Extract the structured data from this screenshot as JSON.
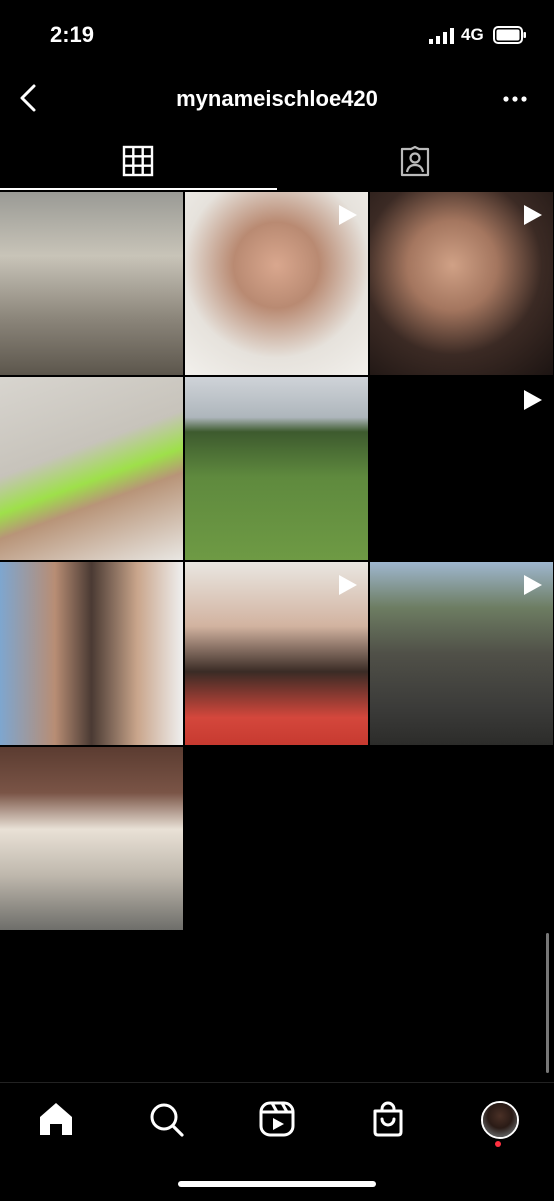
{
  "status_bar": {
    "time": "2:19",
    "network": "4G",
    "icons": [
      "signal-icon",
      "battery-icon"
    ]
  },
  "header": {
    "username": "mynameischloe420",
    "icons": [
      "back-chevron-icon",
      "more-options-icon"
    ]
  },
  "tabs": [
    {
      "name": "posts-grid",
      "icon": "grid-icon",
      "active": true
    },
    {
      "name": "tagged",
      "icon": "tagged-person-icon",
      "active": false
    }
  ],
  "posts": [
    {
      "type": "photo"
    },
    {
      "type": "video"
    },
    {
      "type": "video"
    },
    {
      "type": "photo"
    },
    {
      "type": "photo"
    },
    {
      "type": "video"
    },
    {
      "type": "photo"
    },
    {
      "type": "video"
    },
    {
      "type": "video"
    },
    {
      "type": "photo"
    }
  ],
  "bottom_nav": [
    {
      "name": "home",
      "icon": "home-icon",
      "active": true
    },
    {
      "name": "search",
      "icon": "search-icon",
      "active": false
    },
    {
      "name": "reels",
      "icon": "reels-icon",
      "active": false
    },
    {
      "name": "shop",
      "icon": "shop-bag-icon",
      "active": false
    },
    {
      "name": "profile",
      "icon": "profile-avatar",
      "active": false
    }
  ],
  "colors": {
    "background": "#000000",
    "text": "#ffffff",
    "notification": "#ff3040"
  }
}
